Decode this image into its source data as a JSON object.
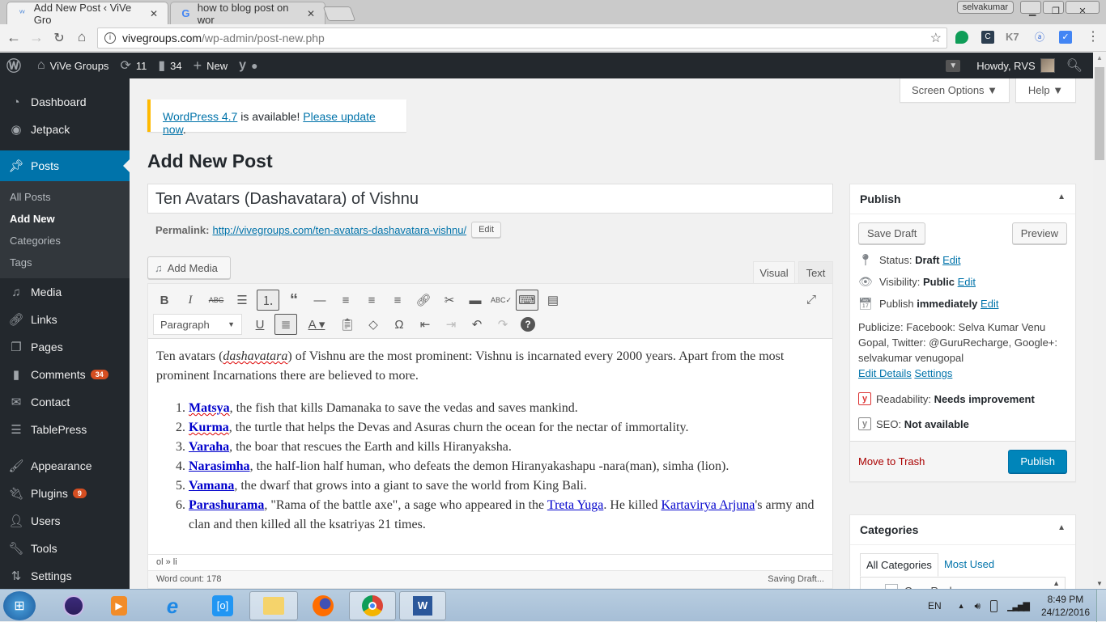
{
  "browser": {
    "tabs": [
      {
        "title": "Add New Post ‹ ViVe Gro",
        "active": true
      },
      {
        "title": "how to blog post on wor",
        "active": false
      }
    ],
    "profile_name": "selvakumar",
    "url_host": "vivegroups.com",
    "url_path": "/wp-admin/post-new.php",
    "extensions": [
      "hangouts-icon",
      "c-extension-icon",
      "k7-icon",
      "a-extension-icon",
      "check-extension-icon"
    ]
  },
  "admin_bar": {
    "site_name": "ViVe Groups",
    "updates_count": "11",
    "comments_count": "34",
    "new_label": "New",
    "howdy": "Howdy, RVS"
  },
  "sidebar": {
    "items": [
      {
        "label": "Dashboard",
        "icon": "dashboard-icon"
      },
      {
        "label": "Jetpack",
        "icon": "jetpack-icon"
      },
      {
        "label": "Posts",
        "icon": "pin-icon",
        "current": true
      },
      {
        "label": "Media",
        "icon": "media-icon"
      },
      {
        "label": "Links",
        "icon": "link-icon"
      },
      {
        "label": "Pages",
        "icon": "pages-icon"
      },
      {
        "label": "Comments",
        "icon": "comment-icon",
        "badge": "34"
      },
      {
        "label": "Contact",
        "icon": "mail-icon"
      },
      {
        "label": "TablePress",
        "icon": "table-icon"
      },
      {
        "label": "Appearance",
        "icon": "brush-icon"
      },
      {
        "label": "Plugins",
        "icon": "plugin-icon",
        "badge": "9"
      },
      {
        "label": "Users",
        "icon": "user-icon"
      },
      {
        "label": "Tools",
        "icon": "wrench-icon"
      },
      {
        "label": "Settings",
        "icon": "settings-icon"
      }
    ],
    "posts_submenu": [
      {
        "label": "All Posts"
      },
      {
        "label": "Add New",
        "current": true
      },
      {
        "label": "Categories"
      },
      {
        "label": "Tags"
      }
    ]
  },
  "header": {
    "screen_options": "Screen Options ▼",
    "help": "Help ▼"
  },
  "notice": {
    "link1": "WordPress 4.7",
    "text": " is available! ",
    "link2": "Please update now",
    "end": "."
  },
  "page_title": "Add New Post",
  "post": {
    "title": "Ten Avatars (Dashavatara) of Vishnu",
    "permalink_label": "Permalink:",
    "permalink_url": "http://vivegroups.com/ten-avatars-dashavatara-vishnu/",
    "permalink_edit": "Edit"
  },
  "editor": {
    "add_media": "Add Media",
    "tab_visual": "Visual",
    "tab_text": "Text",
    "format_select": "Paragraph",
    "intro_1": "Ten avatars (",
    "intro_italic": "dashavatara",
    "intro_2": ") of Vishnu are the most prominent: Vishnu is incarnated every 2000 years. Apart from the most prominent Incarnations there are believed to more.",
    "list": [
      {
        "name": "Matsya",
        "text": ", the fish that kills Damanaka to save the vedas and saves mankind."
      },
      {
        "name": "Kurma",
        "text": ", the turtle that helps the Devas and Asuras churn the ocean for the nectar of immortality."
      },
      {
        "name": "Varaha",
        "text": ", the boar that rescues the Earth and kills Hiranyaksha."
      },
      {
        "name": "Narasimha",
        "text": ", the half-lion half human, who defeats the demon Hiranyakashapu -nara(man), simha (lion)."
      },
      {
        "name": "Vamana",
        "text": ", the dwarf that grows into a giant to save the world from King Bali."
      },
      {
        "name": "Parashurama",
        "text_a": ", \"Rama of the battle axe\", a sage who appeared in the ",
        "link_a": "Treta Yuga",
        "text_b": ". He killed ",
        "link_b": "Kartavirya Arjuna",
        "text_c": "'s army and clan and then killed all the ksatriyas 21 times."
      }
    ],
    "path": "ol » li",
    "word_count": "Word count: 178",
    "save_status": "Saving Draft..."
  },
  "publish": {
    "title": "Publish",
    "save_draft": "Save Draft",
    "preview": "Preview",
    "status_label": "Status:",
    "status_value": "Draft",
    "visibility_label": "Visibility:",
    "visibility_value": "Public",
    "publish_label": "Publish",
    "publish_value": "immediately",
    "edit": "Edit",
    "publicize": "Publicize: Facebook: Selva Kumar Venu Gopal, Twitter: @GuruRecharge, Google+: selvakumar venugopal",
    "edit_details": "Edit Details",
    "settings": "Settings",
    "readability_label": "Readability:",
    "readability_value": "Needs improvement",
    "seo_label": "SEO:",
    "seo_value": "Not available",
    "trash": "Move to Trash",
    "publish_button": "Publish"
  },
  "categories": {
    "title": "Categories",
    "tab_all": "All Categories",
    "tab_most_used": "Most Used",
    "items": [
      "Guru Recharge"
    ]
  },
  "taskbar": {
    "apps": [
      "start-button",
      "eclipse-icon",
      "media-player-icon",
      "internet-explorer-icon",
      "screenshot-icon",
      "file-explorer-icon",
      "firefox-icon",
      "chrome-icon",
      "word-icon"
    ],
    "language": "EN",
    "time": "8:49 PM",
    "date": "24/12/2016"
  }
}
